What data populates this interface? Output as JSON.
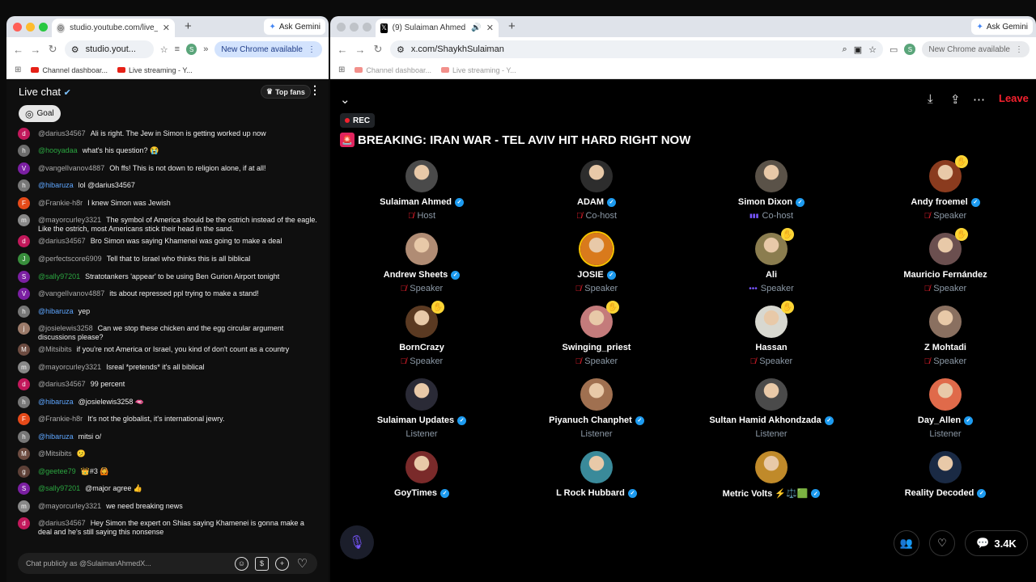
{
  "left_window": {
    "tab_title": "studio.youtube.com/live_chat",
    "address": "studio.yout...",
    "new_chrome": "New Chrome available",
    "ask_gemini": "Ask Gemini",
    "profile_initial": "S",
    "bookmarks": [
      "Channel dashboar...",
      "Live streaming - Y..."
    ],
    "chat": {
      "title": "Live chat",
      "top_fans": "Top fans",
      "goal": "Goal",
      "input_placeholder": "Chat publicly as @SulaimanAhmedX...",
      "messages": [
        {
          "initial": "d",
          "color": "#c2185b",
          "author": "@darius34567",
          "author_color": "gray",
          "text": "Ali is right. The Jew in Simon is getting worked up now"
        },
        {
          "initial": "h",
          "color": "#6d6d6d",
          "author": "@hooyadaa",
          "author_color": "green",
          "text": "what's his question? 😭"
        },
        {
          "initial": "V",
          "color": "#7b1fa2",
          "author": "@vangelIvanov4887",
          "author_color": "gray",
          "text": "Oh ffs! This is not down to religion alone, if at all!"
        },
        {
          "initial": "h",
          "color": "#777",
          "author": "@hibaruza",
          "author_color": "blue",
          "text": "lol @darius34567"
        },
        {
          "initial": "F",
          "color": "#e64a19",
          "author": "@Frankie-h8r",
          "author_color": "gray",
          "text": "I knew Simon was Jewish"
        },
        {
          "initial": "m",
          "color": "#888",
          "author": "@mayorcurley3321",
          "author_color": "gray",
          "text": "The symbol of America should be the ostrich instead of the eagle. Like the ostrich, most Americans stick their head in the sand."
        },
        {
          "initial": "d",
          "color": "#c2185b",
          "author": "@darius34567",
          "author_color": "gray",
          "text": "Bro Simon was saying Khamenei was going to make a deal"
        },
        {
          "initial": "J",
          "color": "#388e3c",
          "author": "@perfectscore6909",
          "author_color": "gray",
          "text": "Tell that to Israel who thinks this is all biblical"
        },
        {
          "initial": "S",
          "color": "#7b1fa2",
          "author": "@sally97201",
          "author_color": "green",
          "text": "Stratotankers 'appear' to be using Ben Gurion Airport tonight"
        },
        {
          "initial": "V",
          "color": "#7b1fa2",
          "author": "@vangelIvanov4887",
          "author_color": "gray",
          "text": "its about repressed ppl trying to make a stand!"
        },
        {
          "initial": "h",
          "color": "#777",
          "author": "@hibaruza",
          "author_color": "blue",
          "text": "yep"
        },
        {
          "initial": "j",
          "color": "#9c7b6a",
          "author": "@josielewis3258",
          "author_color": "gray",
          "text": "Can we stop these chicken and the egg circular argument discussions please?"
        },
        {
          "initial": "M",
          "color": "#6d4c41",
          "author": "@Mitsibits",
          "author_color": "gray",
          "text": "if you're not America or Israel, you kind of don't count as a country"
        },
        {
          "initial": "m",
          "color": "#888",
          "author": "@mayorcurley3321",
          "author_color": "gray",
          "text": "Isreal *pretends* it's all biblical"
        },
        {
          "initial": "d",
          "color": "#c2185b",
          "author": "@darius34567",
          "author_color": "gray",
          "text": "99 percent"
        },
        {
          "initial": "h",
          "color": "#777",
          "author": "@hibaruza",
          "author_color": "blue",
          "text": "@josielewis3258 🫦"
        },
        {
          "initial": "F",
          "color": "#e64a19",
          "author": "@Frankie-h8r",
          "author_color": "gray",
          "text": "It's not the globalist, it's international jewry."
        },
        {
          "initial": "h",
          "color": "#777",
          "author": "@hibaruza",
          "author_color": "blue",
          "text": "mitsi o/"
        },
        {
          "initial": "M",
          "color": "#6d4c41",
          "author": "@Mitsibits",
          "author_color": "gray",
          "text": "🫤"
        },
        {
          "initial": "g",
          "color": "#5d4037",
          "author": "@geetee79",
          "author_color": "green",
          "text": "👑#3  🙆"
        },
        {
          "initial": "S",
          "color": "#7b1fa2",
          "author": "@sally97201",
          "author_color": "green",
          "text": "@major agree 👍"
        },
        {
          "initial": "m",
          "color": "#888",
          "author": "@mayorcurley3321",
          "author_color": "gray",
          "text": "we need breaking news"
        },
        {
          "initial": "d",
          "color": "#c2185b",
          "author": "@darius34567",
          "author_color": "gray",
          "text": "Hey Simon the expert on Shias saying Khamenei is gonna make a deal and he's still saying this nonsense"
        }
      ]
    }
  },
  "right_window": {
    "tab_title": "(9) Sulaiman Ahmed (@Sh...",
    "address": "x.com/ShaykhSulaiman",
    "new_chrome": "New Chrome available",
    "ask_gemini": "Ask Gemini",
    "profile_initial": "S",
    "bookmarks": [
      "Channel dashboar...",
      "Live streaming - Y..."
    ],
    "space": {
      "leave": "Leave",
      "rec": "REC",
      "title": "BREAKING: IRAN WAR  - TEL AVIV HIT HARD RIGHT NOW",
      "listener_count": "3.4K",
      "participants": [
        {
          "name": "Sulaiman Ahmed",
          "verified": true,
          "role": "Host",
          "role_icon": "muted",
          "hand": false,
          "avatar_color": "#4a4a4a"
        },
        {
          "name": "ADAM",
          "verified": true,
          "role": "Co-host",
          "role_icon": "muted",
          "hand": false,
          "avatar_color": "#2d2d2d"
        },
        {
          "name": "Simon Dixon",
          "verified": true,
          "role": "Co-host",
          "role_icon": "speaking",
          "hand": false,
          "avatar_color": "#5a5248"
        },
        {
          "name": "Andy froemel",
          "verified": true,
          "role": "Speaker",
          "role_icon": "muted",
          "hand": true,
          "avatar_color": "#8a3b1e"
        },
        {
          "name": "Andrew Sheets",
          "verified": true,
          "role": "Speaker",
          "role_icon": "muted",
          "hand": false,
          "avatar_color": "#b08c74"
        },
        {
          "name": "JOSIE",
          "verified": true,
          "role": "Speaker",
          "role_icon": "muted",
          "hand": false,
          "avatar_color": "#d97a1c"
        },
        {
          "name": "Ali",
          "verified": false,
          "role": "Speaker",
          "role_icon": "dots",
          "hand": true,
          "avatar_color": "#8b7d4f"
        },
        {
          "name": "Mauricio Fernández",
          "verified": false,
          "role": "Speaker",
          "role_icon": "muted",
          "hand": true,
          "avatar_color": "#6b4f4f"
        },
        {
          "name": "BornCrazy",
          "verified": false,
          "role": "Speaker",
          "role_icon": "muted",
          "hand": true,
          "avatar_color": "#5b3a22"
        },
        {
          "name": "Swinging_priest",
          "verified": false,
          "role": "Speaker",
          "role_icon": "muted",
          "hand": true,
          "avatar_color": "#c47b7b"
        },
        {
          "name": "Hassan",
          "verified": false,
          "role": "Speaker",
          "role_icon": "muted",
          "hand": true,
          "avatar_color": "#d8d8d0"
        },
        {
          "name": "Z Mohtadi",
          "verified": false,
          "role": "Speaker",
          "role_icon": "muted",
          "hand": false,
          "avatar_color": "#8a7060"
        },
        {
          "name": "Sulaiman Updates",
          "verified": true,
          "role": "Listener",
          "role_icon": "none",
          "hand": false,
          "avatar_color": "#2a2a36"
        },
        {
          "name": "Piyanuch Chanphet",
          "verified": true,
          "role": "Listener",
          "role_icon": "none",
          "hand": false,
          "avatar_color": "#a07050"
        },
        {
          "name": "Sultan Hamid Akhondzada",
          "verified": true,
          "role": "Listener",
          "role_icon": "none",
          "hand": false,
          "avatar_color": "#4a4a4a"
        },
        {
          "name": "Day_Allen",
          "verified": true,
          "role": "Listener",
          "role_icon": "none",
          "hand": false,
          "avatar_color": "#e06a4a"
        },
        {
          "name": "GoyTimes",
          "verified": true,
          "role": "",
          "role_icon": "none",
          "hand": false,
          "avatar_color": "#7a2a2a"
        },
        {
          "name": "L Rock Hubbard",
          "verified": true,
          "role": "",
          "role_icon": "none",
          "hand": false,
          "avatar_color": "#3a8a9a"
        },
        {
          "name": "Metric Volts ⚡⚖️🟩",
          "verified": true,
          "role": "",
          "role_icon": "none",
          "hand": false,
          "avatar_color": "#c08a2a"
        },
        {
          "name": "Reality Decoded",
          "verified": true,
          "role": "",
          "role_icon": "none",
          "hand": false,
          "avatar_color": "#1a2a44"
        }
      ]
    }
  }
}
